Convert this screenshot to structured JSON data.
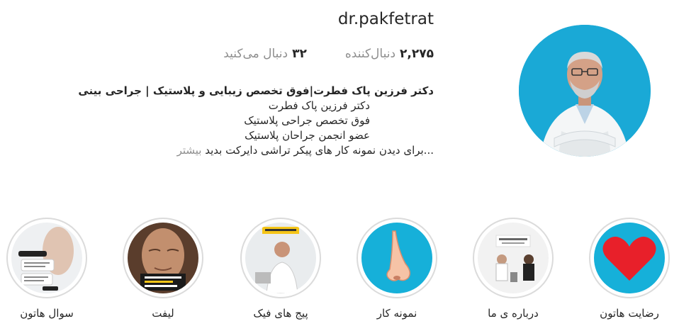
{
  "profile": {
    "username": "dr.pakfetrat",
    "followers_count": "۲,۲۷۵",
    "followers_label": "دنبال‌کننده",
    "following_count": "۳۲",
    "following_label": "دنبال می‌کنید",
    "bio_name": "دکتر فرزین پاک فطرت|فوق تخصص زیبایی و پلاستیک | جراحی بینی",
    "bio_lines": [
      "دکتر فرزین پاک فطرت",
      "فوق تخصص جراحی پلاستیک",
      "عضو انجمن جراحان پلاستیک"
    ],
    "bio_last": "...برای دیدن نمونه کار های پیکر تراشی دایرکت بدید",
    "bio_more": "بیشتر"
  },
  "highlights": [
    {
      "label": "رضایت هاتون",
      "icon": "heart-icon"
    },
    {
      "label": "درباره ی ما",
      "icon": "interview-photo"
    },
    {
      "label": "نمونه کار",
      "icon": "nose-icon"
    },
    {
      "label": "پیج های فیک",
      "icon": "doctor-photo"
    },
    {
      "label": "لیفت",
      "icon": "face-photo"
    },
    {
      "label": "سوال هاتون",
      "icon": "chat-screenshot"
    }
  ],
  "colors": {
    "avatar_bg": "#1aa9d6",
    "heart": "#e8202a",
    "nose_bg": "#16b0d9",
    "secondary_text": "#8e8e8e"
  }
}
